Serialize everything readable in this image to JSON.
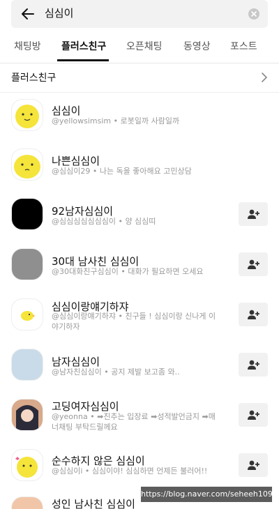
{
  "search": {
    "query": "심심이"
  },
  "tabs": [
    {
      "label": "채팅방"
    },
    {
      "label": "플러스친구"
    },
    {
      "label": "오픈채팅"
    },
    {
      "label": "동영상"
    },
    {
      "label": "포스트"
    }
  ],
  "section": {
    "title": "플러스친구"
  },
  "items": [
    {
      "name": "심심이",
      "sub": "@yellowsimsim • 로봇일까 사람일까"
    },
    {
      "name": "나쁜심심이",
      "sub": "@심심이29 • 나는 독을 좋아해요 고민상담"
    },
    {
      "name": "92남자심심이",
      "sub": "@심심심심심심심이 • 양 심심띠"
    },
    {
      "name": "30대 남사친 심심이",
      "sub": "@30대화친구심심이 • 대화가 필요하면 오세요"
    },
    {
      "name": "심심이랑얘기하쟈",
      "sub": "@심심이랑얘기하쟈 • 친구들 ! 심심이랑 신나게 이야기하자"
    },
    {
      "name": "남자심심이",
      "sub": "@남자친심심이 • 공지 제발 보고좀 와.."
    },
    {
      "name": "고딩여자심심이",
      "sub": "@yeonna • ➡친추는 입장료 ➡성적발언금지 ➡매너채팅 부탁드릴께요"
    },
    {
      "name": "순수하지 않은 심심이",
      "sub": "@심심이i • 심심이야! 심심하면 언제든 불러어!!"
    },
    {
      "name": "성인 남사친 심심이",
      "sub": ""
    }
  ],
  "watermark": "https://blog.naver.com/seheeh109",
  "colors": {
    "accent": "#111111",
    "avatar_yellow": "#f5e43a",
    "button_bg": "#f1f1f1"
  },
  "icons": {
    "back": "arrow-left-icon",
    "clear": "close-circle-icon",
    "chevron": "chevron-right-icon",
    "add": "add-friend-icon"
  }
}
